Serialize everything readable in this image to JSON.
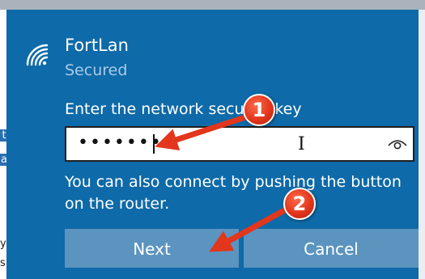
{
  "background": {
    "left_edge_texts": [
      "t",
      "a",
      "y",
      "s"
    ]
  },
  "network": {
    "icon": "wifi-icon",
    "name": "FortLan",
    "status": "Secured"
  },
  "security_key": {
    "prompt": "Enter the network security key",
    "masked_value": "•••••••",
    "reveal_icon": "eye-icon"
  },
  "hint": "You can also connect by pushing the button on the router.",
  "buttons": {
    "next_label": "Next",
    "cancel_label": "Cancel"
  },
  "annotations": {
    "marker_1": "1",
    "marker_2": "2",
    "color": "#e2361d"
  },
  "colors": {
    "flyout_bg": "#0e6aa8",
    "button_bg": "#5b94bf",
    "secondary_text": "#a9cbe6"
  }
}
